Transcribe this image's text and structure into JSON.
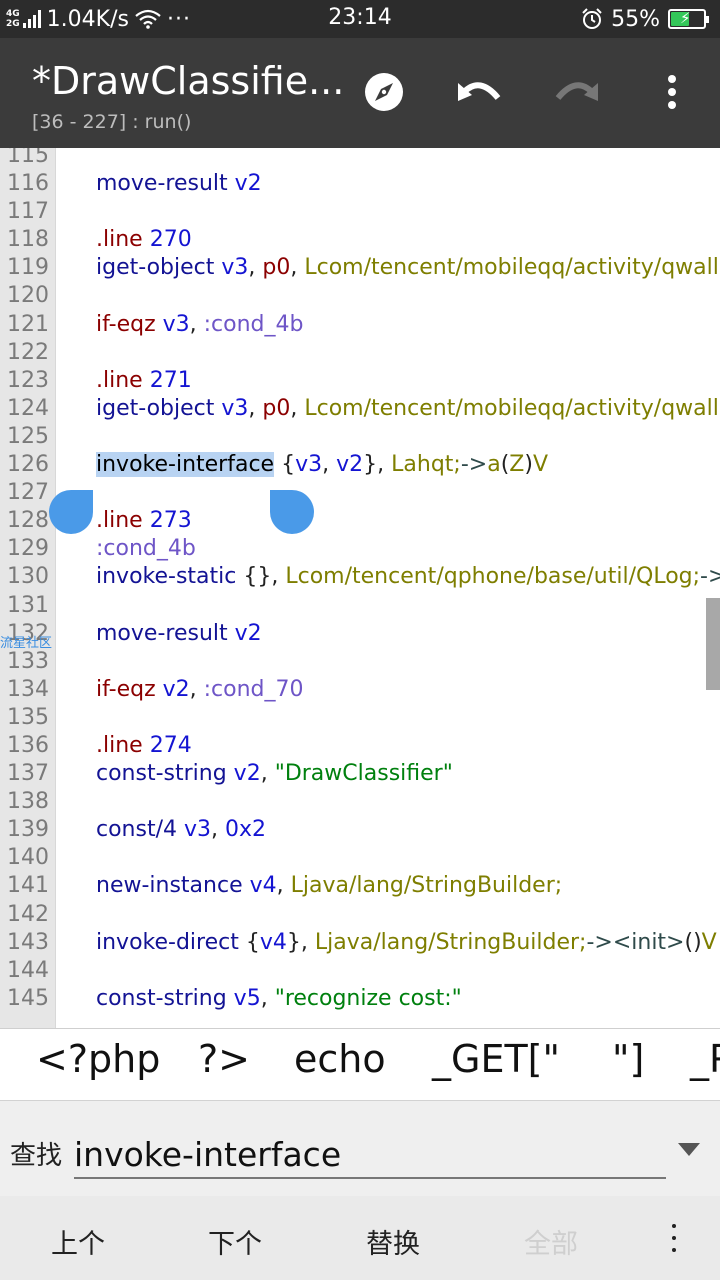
{
  "status_bar": {
    "network_label_top": "4G",
    "network_label_bottom": "2G",
    "speed": "1.04K/s",
    "more": "···",
    "time": "23:14",
    "battery": "55%",
    "battery_level": 0.55,
    "icons": [
      "signal-icon",
      "wifi-icon",
      "alarm-icon",
      "battery-charging-icon"
    ]
  },
  "app_bar": {
    "title": "*DrawClassifie...",
    "subtitle": "[36 - 227] : run()",
    "actions": [
      "compass-icon",
      "undo-icon",
      "redo-icon",
      "more-vert-icon"
    ]
  },
  "editor": {
    "lines": [
      {
        "n": "115",
        "tokens": []
      },
      {
        "n": "116",
        "tokens": [
          [
            "kw",
            "move-result"
          ],
          [
            "reg",
            " v2"
          ]
        ]
      },
      {
        "n": "117",
        "tokens": []
      },
      {
        "n": "118",
        "tokens": [
          [
            "dir",
            ".line"
          ],
          [
            "num",
            " 270"
          ]
        ]
      },
      {
        "n": "119",
        "tokens": [
          [
            "kw",
            "iget-object"
          ],
          [
            "reg",
            " v3"
          ],
          [
            "pun",
            ","
          ],
          [
            "dir",
            " p0"
          ],
          [
            "pun",
            ","
          ],
          [
            "cls",
            " Lcom/tencent/mobileqq/activity/qwalle"
          ]
        ]
      },
      {
        "n": "120",
        "tokens": []
      },
      {
        "n": "121",
        "tokens": [
          [
            "dir",
            "if-eqz"
          ],
          [
            "reg",
            " v3"
          ],
          [
            "pun",
            ","
          ],
          [
            "lbl",
            " :cond_4b"
          ]
        ]
      },
      {
        "n": "122",
        "tokens": []
      },
      {
        "n": "123",
        "tokens": [
          [
            "dir",
            ".line"
          ],
          [
            "num",
            " 271"
          ]
        ]
      },
      {
        "n": "124",
        "tokens": [
          [
            "kw",
            "iget-object"
          ],
          [
            "reg",
            " v3"
          ],
          [
            "pun",
            ","
          ],
          [
            "dir",
            " p0"
          ],
          [
            "pun",
            ","
          ],
          [
            "cls",
            " Lcom/tencent/mobileqq/activity/qwalle"
          ]
        ]
      },
      {
        "n": "125",
        "tokens": []
      },
      {
        "n": "126",
        "tokens": [
          [
            "sel",
            "invoke-interface"
          ],
          [
            "pun",
            " {"
          ],
          [
            "reg",
            "v3"
          ],
          [
            "pun",
            ","
          ],
          [
            "reg",
            " v2"
          ],
          [
            "pun",
            "},"
          ],
          [
            "cls",
            " Lahqt;"
          ],
          [
            "arr",
            "->"
          ],
          [
            "cls",
            "a"
          ],
          [
            "pun",
            "("
          ],
          [
            "cls",
            "Z"
          ],
          [
            "pun",
            ")"
          ],
          [
            "cls",
            "V"
          ]
        ]
      },
      {
        "n": "127",
        "tokens": []
      },
      {
        "n": "128",
        "tokens": [
          [
            "dir",
            ".line"
          ],
          [
            "num",
            " 273"
          ]
        ]
      },
      {
        "n": "129",
        "tokens": [
          [
            "lbl",
            ":cond_4b"
          ]
        ]
      },
      {
        "n": "130",
        "tokens": [
          [
            "kw",
            "invoke-static"
          ],
          [
            "pun",
            " {},"
          ],
          [
            "cls",
            " Lcom/tencent/qphone/base/util/QLog;"
          ],
          [
            "arr",
            "->is"
          ]
        ]
      },
      {
        "n": "131",
        "tokens": []
      },
      {
        "n": "132",
        "tokens": [
          [
            "kw",
            "move-result"
          ],
          [
            "reg",
            " v2"
          ]
        ]
      },
      {
        "n": "133",
        "tokens": []
      },
      {
        "n": "134",
        "tokens": [
          [
            "dir",
            "if-eqz"
          ],
          [
            "reg",
            " v2"
          ],
          [
            "pun",
            ","
          ],
          [
            "lbl",
            " :cond_70"
          ]
        ]
      },
      {
        "n": "135",
        "tokens": []
      },
      {
        "n": "136",
        "tokens": [
          [
            "dir",
            ".line"
          ],
          [
            "num",
            " 274"
          ]
        ]
      },
      {
        "n": "137",
        "tokens": [
          [
            "kw",
            "const-string"
          ],
          [
            "reg",
            " v2"
          ],
          [
            "pun",
            ","
          ],
          [
            "str",
            " \"DrawClassifier\""
          ]
        ]
      },
      {
        "n": "138",
        "tokens": []
      },
      {
        "n": "139",
        "tokens": [
          [
            "kw",
            "const/4"
          ],
          [
            "reg",
            " v3"
          ],
          [
            "pun",
            ","
          ],
          [
            "num",
            " 0x2"
          ]
        ]
      },
      {
        "n": "140",
        "tokens": []
      },
      {
        "n": "141",
        "tokens": [
          [
            "kw",
            "new-instance"
          ],
          [
            "reg",
            " v4"
          ],
          [
            "pun",
            ","
          ],
          [
            "cls",
            " Ljava/lang/StringBuilder;"
          ]
        ]
      },
      {
        "n": "142",
        "tokens": []
      },
      {
        "n": "143",
        "tokens": [
          [
            "kw",
            "invoke-direct"
          ],
          [
            "pun",
            " {"
          ],
          [
            "reg",
            "v4"
          ],
          [
            "pun",
            "},"
          ],
          [
            "cls",
            " Ljava/lang/StringBuilder;"
          ],
          [
            "arr",
            "-><init>"
          ],
          [
            "pun",
            "()"
          ],
          [
            "cls",
            "V"
          ]
        ]
      },
      {
        "n": "144",
        "tokens": []
      },
      {
        "n": "145",
        "tokens": [
          [
            "kw",
            "const-string"
          ],
          [
            "reg",
            " v5"
          ],
          [
            "pun",
            ","
          ],
          [
            "str",
            " \"recognize cost:\""
          ]
        ]
      }
    ],
    "watermark": "流星社区"
  },
  "symbols": [
    "<?php",
    "?>",
    "echo",
    "_GET[\"",
    "\"]",
    "_P"
  ],
  "find_bar": {
    "label": "查找",
    "value": "invoke-interface",
    "dropdown_icon": "triangle-down-icon"
  },
  "actions": {
    "prev": "上个",
    "next": "下个",
    "replace": "替换",
    "all": "全部",
    "more_icon": "more-vert-icon"
  }
}
